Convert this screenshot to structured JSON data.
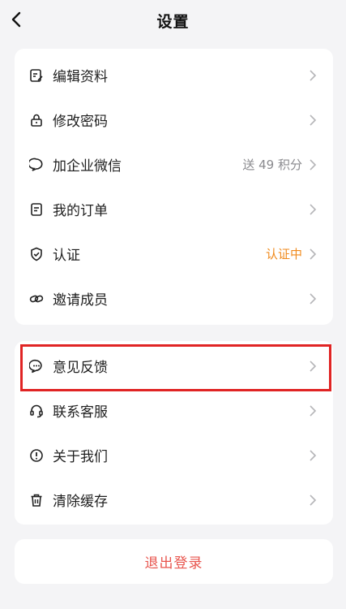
{
  "header": {
    "title": "设置",
    "back_icon": "chevron-left-icon"
  },
  "group1": [
    {
      "label": "编辑资料",
      "icon": "edit-profile-icon",
      "extra": ""
    },
    {
      "label": "修改密码",
      "icon": "lock-icon",
      "extra": ""
    },
    {
      "label": "加企业微信",
      "icon": "wechat-bubble-icon",
      "extra": "送 49 积分"
    },
    {
      "label": "我的订单",
      "icon": "order-document-icon",
      "extra": ""
    },
    {
      "label": "认证",
      "icon": "shield-check-icon",
      "extra": "认证中",
      "extra_color": "#f08a1c"
    },
    {
      "label": "邀请成员",
      "icon": "link-icon",
      "extra": ""
    }
  ],
  "group2": [
    {
      "label": "意见反馈",
      "icon": "feedback-chat-icon",
      "highlighted": true
    },
    {
      "label": "联系客服",
      "icon": "headset-icon"
    },
    {
      "label": "关于我们",
      "icon": "info-icon"
    },
    {
      "label": "清除缓存",
      "icon": "trash-icon"
    }
  ],
  "logout": {
    "label": "退出登录",
    "color": "#e8554e"
  },
  "colors": {
    "background": "#f4f4f6",
    "highlight_border": "#e02424",
    "accent_orange": "#f08a1c"
  }
}
